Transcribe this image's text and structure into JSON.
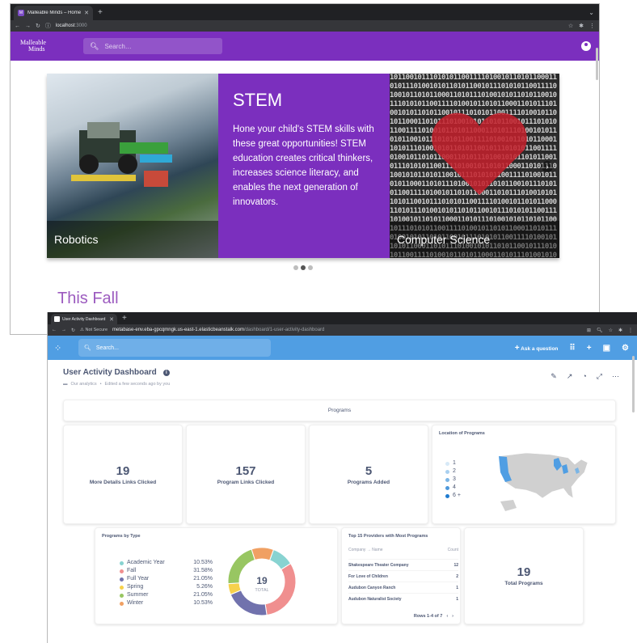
{
  "window1": {
    "tab_title": "Malleable Minds – Home",
    "url_host": "localhost",
    "url_port": ":3000",
    "logo_line1": "Malleable",
    "logo_line2": "Minds",
    "search_placeholder": "Search…",
    "carousel": {
      "slide1_label": "Robotics",
      "slide2_title": "STEM",
      "slide2_body": "Hone your child's STEM skills with these great opportunities! STEM education creates critical thinkers, increases science literacy, and enables the next generation of innovators.",
      "slide3_label": "Computer Science",
      "active_dot": 2
    },
    "section_heading": "This Fall",
    "colors": {
      "brand": "#7b2fbe",
      "heading": "#9c5bbf"
    }
  },
  "window2": {
    "tab_title": "User Activity Dashboard · Dash",
    "not_secure": "Not Secure",
    "url_host": "metabase-env.eba-gpcqmngk.us-east-1.elasticbeanstalk.com",
    "url_path": "/dashboard/1-user-activity-dashboard",
    "search_placeholder": "Search...",
    "ask_question": "Ask a question",
    "dashboard_title": "User Activity Dashboard",
    "collection": "Our analytics",
    "edited": "Edited a few seconds ago by you",
    "programs_header": "Programs",
    "scalars": [
      {
        "value": "19",
        "label": "More Details Links Clicked"
      },
      {
        "value": "157",
        "label": "Program Links Clicked"
      },
      {
        "value": "5",
        "label": "Programs Added"
      }
    ],
    "map": {
      "title": "Location of Programs",
      "legend": [
        "1",
        "2",
        "3",
        "4",
        "6 +"
      ]
    },
    "pie": {
      "title": "Programs by Type",
      "total_value": "19",
      "total_label": "TOTAL"
    },
    "table": {
      "title": "Top 15 Providers with Most Programs",
      "col1": "Company → Name",
      "col2": "Count",
      "rows": [
        {
          "name": "Shakespeare Theater Company",
          "count": "12"
        },
        {
          "name": "For Love of Children",
          "count": "2"
        },
        {
          "name": "Audubon Canyon Ranch",
          "count": "1"
        },
        {
          "name": "Audubon Naturalist Society",
          "count": "1"
        }
      ],
      "pager": "Rows 1-4 of 7"
    },
    "total_programs": {
      "value": "19",
      "label": "Total Programs"
    },
    "colors": {
      "header": "#509ee3",
      "text": "#4c5773"
    }
  },
  "chart_data": {
    "type": "pie",
    "title": "Programs by Type",
    "categories": [
      "Academic Year",
      "Fall",
      "Full Year",
      "Spring",
      "Summer",
      "Winter"
    ],
    "labels_pct": [
      "10.53%",
      "31.58%",
      "21.05%",
      "5.26%",
      "21.05%",
      "10.53%"
    ],
    "values": [
      10.53,
      31.58,
      21.05,
      5.26,
      21.05,
      10.53
    ],
    "colors": [
      "#88d3d1",
      "#f08f8f",
      "#7172ad",
      "#f7d14c",
      "#98c662",
      "#f0a063"
    ],
    "total": 19
  }
}
